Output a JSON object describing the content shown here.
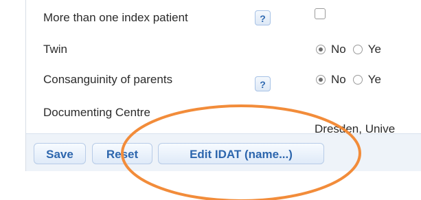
{
  "form": {
    "rows": [
      {
        "label": "More than one index patient",
        "help": "?"
      },
      {
        "label": "Twin",
        "radio_no": "No",
        "radio_yes": "Ye"
      },
      {
        "label": "Consanguinity of parents",
        "help": "?",
        "radio_no": "No",
        "radio_yes": "Ye"
      },
      {
        "label": "Documenting Centre",
        "value": "Dresden, Unive"
      }
    ]
  },
  "toolbar": {
    "save_label": "Save",
    "reset_label": "Reset",
    "edit_label": "Edit IDAT (name...)"
  },
  "colors": {
    "accent": "#2f69b1",
    "panel_border": "#d7dde6",
    "footer_bg": "#eef3f9",
    "highlight": "#f28c3a"
  }
}
